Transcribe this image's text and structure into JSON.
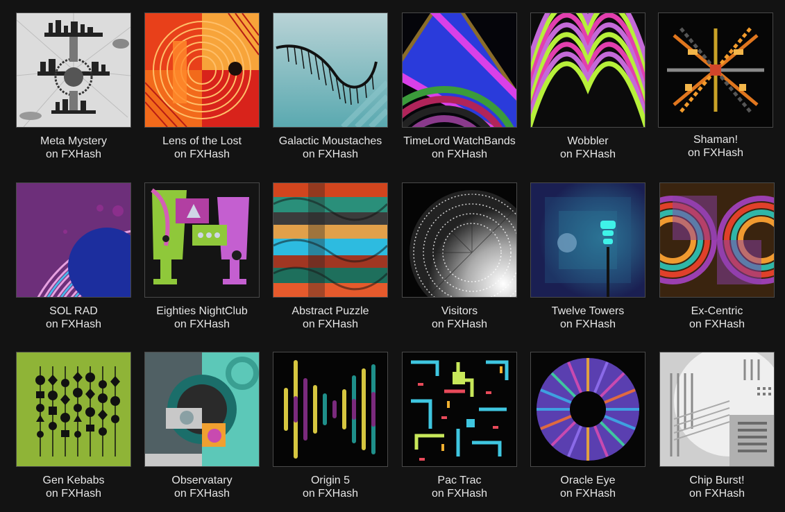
{
  "gallery": {
    "items": [
      {
        "title": "Meta Mystery",
        "platform": "on FXHash"
      },
      {
        "title": "Lens of the Lost",
        "platform": "on FXHash"
      },
      {
        "title": "Galactic Moustaches",
        "platform": "on FXHash"
      },
      {
        "title": "TimeLord WatchBands",
        "platform": "on FXHash"
      },
      {
        "title": "Wobbler",
        "platform": "on FXHash"
      },
      {
        "title": "Shaman!",
        "platform": "on FXHash"
      },
      {
        "title": "SOL RAD",
        "platform": "on FXHash"
      },
      {
        "title": "Eighties NightClub",
        "platform": "on FXHash"
      },
      {
        "title": "Abstract Puzzle",
        "platform": "on FXHash"
      },
      {
        "title": "Visitors",
        "platform": "on FXHash"
      },
      {
        "title": "Twelve Towers",
        "platform": "on FXHash"
      },
      {
        "title": "Ex-Centric",
        "platform": "on FXHash"
      },
      {
        "title": "Gen Kebabs",
        "platform": "on FXHash"
      },
      {
        "title": "Observatary",
        "platform": "on FXHash"
      },
      {
        "title": "Origin 5",
        "platform": "on FXHash"
      },
      {
        "title": "Pac Trac",
        "platform": "on FXHash"
      },
      {
        "title": "Oracle Eye",
        "platform": "on FXHash"
      },
      {
        "title": "Chip Burst!",
        "platform": "on FXHash"
      }
    ]
  },
  "theme": {
    "background": "#131313",
    "text": "#e6e6e6"
  }
}
